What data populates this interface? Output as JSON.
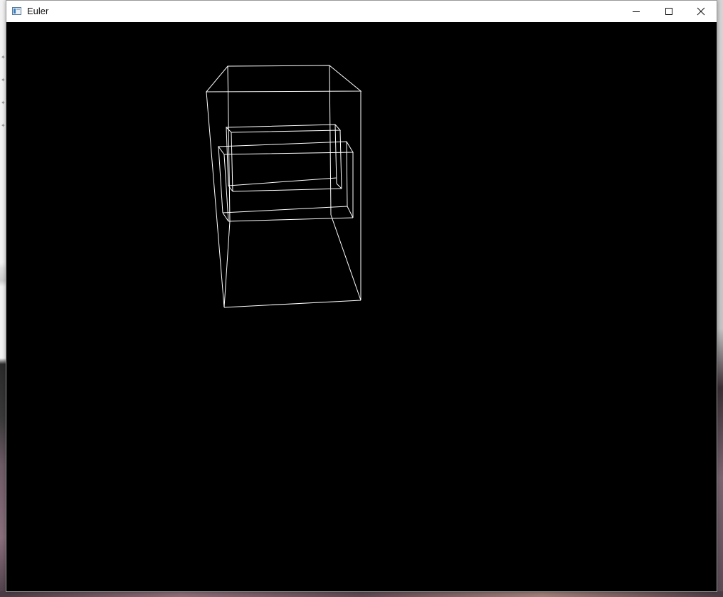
{
  "window": {
    "title": "Euler",
    "controls": {
      "minimize": "minimize-icon",
      "maximize": "maximize-icon",
      "close": "close-icon"
    }
  },
  "viewport": {
    "background": "#000000",
    "line_color": "#ffffff"
  }
}
